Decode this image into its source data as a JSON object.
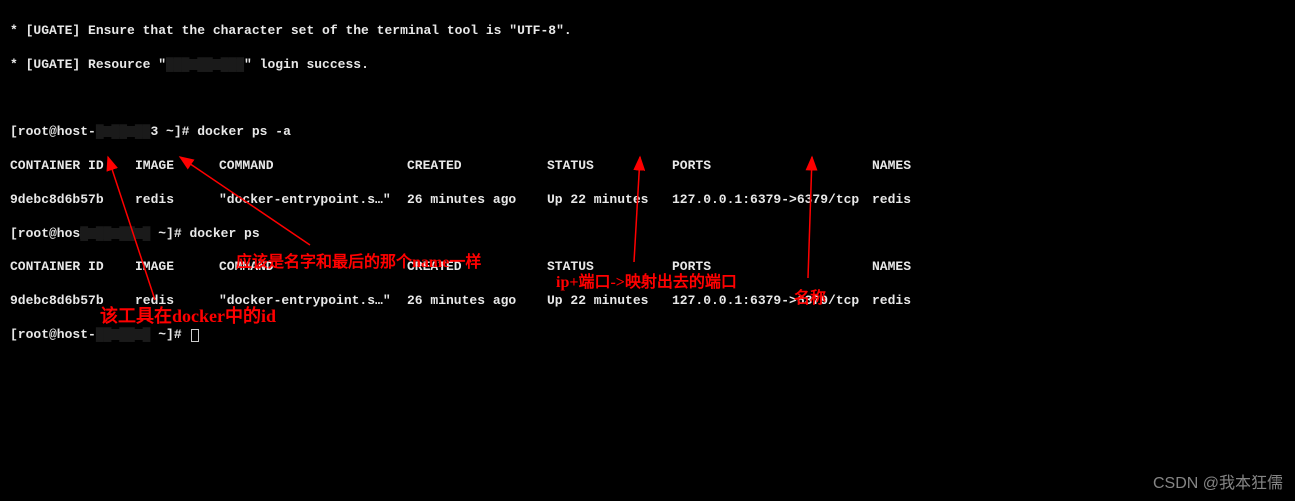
{
  "header": {
    "line1": "* [UGATE] Ensure that the character set of the terminal tool is \"UTF-8\".",
    "line2_prefix": "* [UGATE] Resource \"",
    "line2_redacted": "███ ██ ███",
    "line2_suffix": "\" login success."
  },
  "prompts": {
    "p1_prefix": "[root@host-",
    "p1_redacted": "█ ██ ██",
    "p1_suffix": "3 ~]# ",
    "p1_cmd": "docker ps -a",
    "p2_prefix": "[root@hos",
    "p2_redacted": "█ ██ ██ █",
    "p2_suffix": " ~]# ",
    "p2_cmd": "docker ps",
    "p3_prefix": "[root@host-",
    "p3_redacted": "██ ██ █",
    "p3_suffix": " ~]# "
  },
  "table": {
    "headers": {
      "container_id": "CONTAINER ID",
      "image": "IMAGE",
      "command": "COMMAND",
      "created": "CREATED",
      "status": "STATUS",
      "ports": "PORTS",
      "names": "NAMES"
    },
    "row1": {
      "container_id": "9debc8d6b57b",
      "image": "redis",
      "command": "\"docker-entrypoint.s…\"",
      "created": "26 minutes ago",
      "status": "Up 22 minutes",
      "ports": "127.0.0.1:6379->6379/tcp",
      "names": "redis"
    },
    "row2": {
      "container_id": "9debc8d6b57b",
      "image": "redis",
      "command": "\"docker-entrypoint.s…\"",
      "created": "26 minutes ago",
      "status": "Up 22 minutes",
      "ports": "127.0.0.1:6379->6379/tcp",
      "names": "redis"
    }
  },
  "annotations": {
    "id_label": "该工具在docker中的id",
    "image_label": "应该是名字和最后的那个name一样",
    "ports_label": "ip+端口->映射出去的端口",
    "names_label": "名称"
  },
  "watermark": "CSDN @我本狂儒"
}
